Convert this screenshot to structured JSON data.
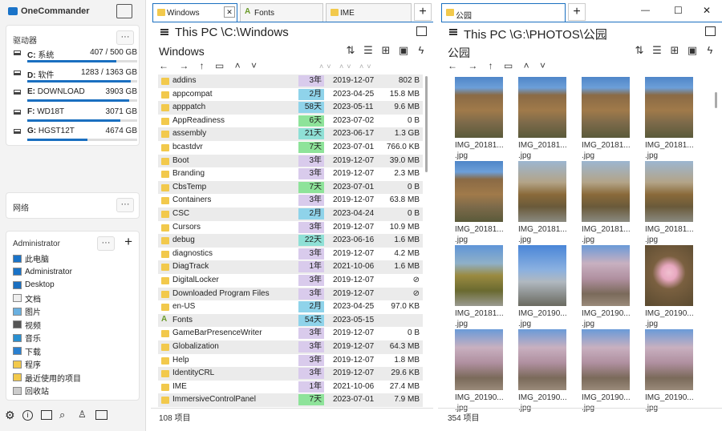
{
  "app": {
    "title": "OneCommander"
  },
  "left": {
    "drives_header": "驱动器",
    "more": "···",
    "drives": [
      {
        "letter": "C:",
        "name": "系统",
        "size": "407 / 500 GB",
        "used": 0.81
      },
      {
        "letter": "D:",
        "name": "软件",
        "size": "1283 / 1363 GB",
        "used": 0.94
      },
      {
        "letter": "E:",
        "name": "DOWNLOAD",
        "size": "3903 GB",
        "used": 0.93
      },
      {
        "letter": "F:",
        "name": "WD18T",
        "size": "3071 GB",
        "used": 0.85
      },
      {
        "letter": "G:",
        "name": "HGST12T",
        "size": "4674 GB",
        "used": 0.55
      }
    ],
    "network_header": "网络",
    "user_header": "Administrator",
    "plus": "+",
    "favorites": [
      {
        "label": "此电脑",
        "icon": "pc-icon"
      },
      {
        "label": "Administrator",
        "icon": "user-icon"
      },
      {
        "label": "Desktop",
        "icon": "desktop-icon"
      },
      {
        "label": "文档",
        "icon": "document-icon"
      },
      {
        "label": "图片",
        "icon": "picture-icon"
      },
      {
        "label": "视频",
        "icon": "video-icon"
      },
      {
        "label": "音乐",
        "icon": "music-icon"
      },
      {
        "label": "下载",
        "icon": "download-icon"
      },
      {
        "label": "程序",
        "icon": "folder-icon"
      },
      {
        "label": "最近使用的项目",
        "icon": "recent-icon"
      },
      {
        "label": "回收站",
        "icon": "recycle-bin-icon"
      }
    ]
  },
  "pane1": {
    "tabs": [
      "Windows",
      "Fonts",
      "IME"
    ],
    "path": "This PC \\C:\\Windows",
    "title": "Windows",
    "status": "108 项目",
    "rows": [
      {
        "name": "addins",
        "age": "3年",
        "date": "2019-12-07",
        "size": "802 B",
        "c": "#d9cbec"
      },
      {
        "name": "appcompat",
        "age": "2月",
        "date": "2023-04-25",
        "size": "15.8 MB",
        "c": "#8fd3ea"
      },
      {
        "name": "apppatch",
        "age": "58天",
        "date": "2023-05-11",
        "size": "9.6 MB",
        "c": "#8fd3ea"
      },
      {
        "name": "AppReadiness",
        "age": "6天",
        "date": "2023-07-02",
        "size": "0 B",
        "c": "#8ee39a"
      },
      {
        "name": "assembly",
        "age": "21天",
        "date": "2023-06-17",
        "size": "1.3 GB",
        "c": "#8fe0d6"
      },
      {
        "name": "bcastdvr",
        "age": "7天",
        "date": "2023-07-01",
        "size": "766.0 KB",
        "c": "#8ee39a"
      },
      {
        "name": "Boot",
        "age": "3年",
        "date": "2019-12-07",
        "size": "39.0 MB",
        "c": "#d9cbec"
      },
      {
        "name": "Branding",
        "age": "3年",
        "date": "2019-12-07",
        "size": "2.3 MB",
        "c": "#d9cbec"
      },
      {
        "name": "CbsTemp",
        "age": "7天",
        "date": "2023-07-01",
        "size": "0 B",
        "c": "#8ee39a"
      },
      {
        "name": "Containers",
        "age": "3年",
        "date": "2019-12-07",
        "size": "63.8 MB",
        "c": "#d9cbec"
      },
      {
        "name": "CSC",
        "age": "2月",
        "date": "2023-04-24",
        "size": "0 B",
        "c": "#8fd3ea"
      },
      {
        "name": "Cursors",
        "age": "3年",
        "date": "2019-12-07",
        "size": "10.9 MB",
        "c": "#d9cbec"
      },
      {
        "name": "debug",
        "age": "22天",
        "date": "2023-06-16",
        "size": "1.6 MB",
        "c": "#8fe0d6"
      },
      {
        "name": "diagnostics",
        "age": "3年",
        "date": "2019-12-07",
        "size": "4.2 MB",
        "c": "#d9cbec"
      },
      {
        "name": "DiagTrack",
        "age": "1年",
        "date": "2021-10-06",
        "size": "1.6 MB",
        "c": "#d9cbec"
      },
      {
        "name": "DigitalLocker",
        "age": "3年",
        "date": "2019-12-07",
        "size": "⊘",
        "c": "#d9cbec"
      },
      {
        "name": "Downloaded Program Files",
        "age": "3年",
        "date": "2019-12-07",
        "size": "⊘",
        "c": "#d9cbec"
      },
      {
        "name": "en-US",
        "age": "2月",
        "date": "2023-04-25",
        "size": "97.0 KB",
        "c": "#8fd3ea"
      },
      {
        "name": "Fonts",
        "age": "54天",
        "date": "2023-05-15",
        "size": "",
        "c": "#8fd3ea",
        "font": true
      },
      {
        "name": "GameBarPresenceWriter",
        "age": "3年",
        "date": "2019-12-07",
        "size": "0 B",
        "c": "#d9cbec"
      },
      {
        "name": "Globalization",
        "age": "3年",
        "date": "2019-12-07",
        "size": "64.3 MB",
        "c": "#d9cbec"
      },
      {
        "name": "Help",
        "age": "3年",
        "date": "2019-12-07",
        "size": "1.8 MB",
        "c": "#d9cbec"
      },
      {
        "name": "IdentityCRL",
        "age": "3年",
        "date": "2019-12-07",
        "size": "29.6 KB",
        "c": "#d9cbec"
      },
      {
        "name": "IME",
        "age": "1年",
        "date": "2021-10-06",
        "size": "27.4 MB",
        "c": "#d9cbec"
      },
      {
        "name": "ImmersiveControlPanel",
        "age": "7天",
        "date": "2023-07-01",
        "size": "7.9 MB",
        "c": "#8ee39a"
      }
    ]
  },
  "pane2": {
    "tab": "公园",
    "path": "This PC \\G:\\PHOTOS\\公园",
    "title": "公园",
    "status": "354 项目",
    "thumbs": [
      {
        "l1": "IMG_20181...",
        "l2": ".jpg",
        "kind": "rock"
      },
      {
        "l1": "IMG_20181...",
        "l2": ".jpg",
        "kind": "rock"
      },
      {
        "l1": "IMG_20181...",
        "l2": ".jpg",
        "kind": "rock"
      },
      {
        "l1": "IMG_20181...",
        "l2": ".jpg",
        "kind": "rock"
      },
      {
        "l1": "IMG_20181...",
        "l2": ".jpg",
        "kind": "rock"
      },
      {
        "l1": "IMG_20181...",
        "l2": ".jpg",
        "kind": "park"
      },
      {
        "l1": "IMG_20181...",
        "l2": ".jpg",
        "kind": "park"
      },
      {
        "l1": "IMG_20181...",
        "l2": ".jpg",
        "kind": "park"
      },
      {
        "l1": "IMG_20181...",
        "l2": ".jpg",
        "kind": "tree"
      },
      {
        "l1": "IMG_20190...",
        "l2": ".jpg",
        "kind": "building"
      },
      {
        "l1": "IMG_20190...",
        "l2": ".jpg",
        "kind": "blossom"
      },
      {
        "l1": "IMG_20190...",
        "l2": ".jpg",
        "kind": "flower"
      },
      {
        "l1": "IMG_20190...",
        "l2": ".jpg",
        "kind": "blossom"
      },
      {
        "l1": "IMG_20190...",
        "l2": ".jpg",
        "kind": "blossom"
      },
      {
        "l1": "IMG_20190...",
        "l2": ".jpg",
        "kind": "blossom"
      },
      {
        "l1": "IMG_20190...",
        "l2": ".jpg",
        "kind": "blossom"
      }
    ]
  },
  "toolbar": {
    "sort": "⇅",
    "list": "☰",
    "add": "⊞",
    "paste": "▣",
    "bolt": "ϟ"
  },
  "window": {
    "min": "—",
    "max": "☐",
    "close": "✕"
  },
  "nav": "← → ↑ ▭ ˄ ˅",
  "sortcarets": "˄˅ ˄˅ ˄˅"
}
